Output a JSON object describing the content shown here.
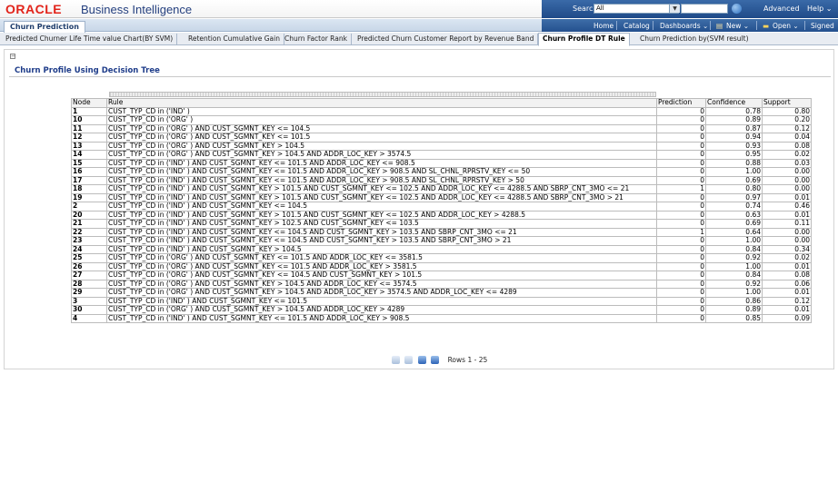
{
  "banner": {
    "oracle_logo": "ORACLE",
    "product": "Business Intelligence",
    "search_label": "Search",
    "search_scope": "All",
    "advanced": "Advanced",
    "help": "Help ⌄"
  },
  "nav": {
    "app_tab": "Churn Prediction",
    "home": "Home",
    "catalog": "Catalog",
    "dashboards": "Dashboards ⌄",
    "new": "New ⌄",
    "open": "Open ⌄",
    "signed": "Signed"
  },
  "page_tabs": [
    "Predicted Churner Life Time value Chart(BY SVM)",
    "Retention Cumulative Gain",
    "Churn Factor Rank",
    "Predicted Churn Customer Report by Revenue Band",
    "Churn Profile DT Rule",
    "Churn Prediction by(SVM result)"
  ],
  "section": {
    "title": "Churn Profile Using Decision Tree"
  },
  "table": {
    "headers": [
      "Node",
      "Rule",
      "Prediction",
      "Confidence",
      "Support"
    ],
    "rows": [
      [
        "1",
        "CUST_TYP_CD in ('IND' )",
        "0",
        "0.78",
        "0.80"
      ],
      [
        "10",
        "CUST_TYP_CD in ('ORG' )",
        "0",
        "0.89",
        "0.20"
      ],
      [
        "11",
        "CUST_TYP_CD in ('ORG' ) AND CUST_SGMNT_KEY <= 104.5",
        "0",
        "0.87",
        "0.12"
      ],
      [
        "12",
        "CUST_TYP_CD in ('ORG' ) AND CUST_SGMNT_KEY <= 101.5",
        "0",
        "0.94",
        "0.04"
      ],
      [
        "13",
        "CUST_TYP_CD in ('ORG' ) AND CUST_SGMNT_KEY > 104.5",
        "0",
        "0.93",
        "0.08"
      ],
      [
        "14",
        "CUST_TYP_CD in ('ORG' ) AND CUST_SGMNT_KEY > 104.5 AND ADDR_LOC_KEY > 3574.5",
        "0",
        "0.95",
        "0.02"
      ],
      [
        "15",
        "CUST_TYP_CD in ('IND' ) AND CUST_SGMNT_KEY <= 101.5 AND ADDR_LOC_KEY <= 908.5",
        "0",
        "0.88",
        "0.03"
      ],
      [
        "16",
        "CUST_TYP_CD in ('IND' ) AND CUST_SGMNT_KEY <= 101.5 AND ADDR_LOC_KEY > 908.5 AND SL_CHNL_RPRSTV_KEY <= 50",
        "0",
        "1.00",
        "0.00"
      ],
      [
        "17",
        "CUST_TYP_CD in ('IND' ) AND CUST_SGMNT_KEY <= 101.5 AND ADDR_LOC_KEY > 908.5 AND SL_CHNL_RPRSTV_KEY > 50",
        "0",
        "0.69",
        "0.00"
      ],
      [
        "18",
        "CUST_TYP_CD in ('IND' ) AND CUST_SGMNT_KEY > 101.5 AND CUST_SGMNT_KEY <= 102.5 AND ADDR_LOC_KEY <= 4288.5 AND SBRP_CNT_3MO <= 21",
        "1",
        "0.80",
        "0.00"
      ],
      [
        "19",
        "CUST_TYP_CD in ('IND' ) AND CUST_SGMNT_KEY > 101.5 AND CUST_SGMNT_KEY <= 102.5 AND ADDR_LOC_KEY <= 4288.5 AND SBRP_CNT_3MO > 21",
        "0",
        "0.97",
        "0.01"
      ],
      [
        "2",
        "CUST_TYP_CD in ('IND' ) AND CUST_SGMNT_KEY <= 104.5",
        "0",
        "0.74",
        "0.46"
      ],
      [
        "20",
        "CUST_TYP_CD in ('IND' ) AND CUST_SGMNT_KEY > 101.5 AND CUST_SGMNT_KEY <= 102.5 AND ADDR_LOC_KEY > 4288.5",
        "0",
        "0.63",
        "0.01"
      ],
      [
        "21",
        "CUST_TYP_CD in ('IND' ) AND CUST_SGMNT_KEY > 102.5 AND CUST_SGMNT_KEY <= 103.5",
        "0",
        "0.69",
        "0.11"
      ],
      [
        "22",
        "CUST_TYP_CD in ('IND' ) AND CUST_SGMNT_KEY <= 104.5 AND CUST_SGMNT_KEY > 103.5 AND SBRP_CNT_3MO <= 21",
        "1",
        "0.64",
        "0.00"
      ],
      [
        "23",
        "CUST_TYP_CD in ('IND' ) AND CUST_SGMNT_KEY <= 104.5 AND CUST_SGMNT_KEY > 103.5 AND SBRP_CNT_3MO > 21",
        "0",
        "1.00",
        "0.00"
      ],
      [
        "24",
        "CUST_TYP_CD in ('IND' ) AND CUST_SGMNT_KEY > 104.5",
        "0",
        "0.84",
        "0.34"
      ],
      [
        "25",
        "CUST_TYP_CD in ('ORG' ) AND CUST_SGMNT_KEY <= 101.5 AND ADDR_LOC_KEY <= 3581.5",
        "0",
        "0.92",
        "0.02"
      ],
      [
        "26",
        "CUST_TYP_CD in ('ORG' ) AND CUST_SGMNT_KEY <= 101.5 AND ADDR_LOC_KEY > 3581.5",
        "0",
        "1.00",
        "0.01"
      ],
      [
        "27",
        "CUST_TYP_CD in ('ORG' ) AND CUST_SGMNT_KEY <= 104.5 AND CUST_SGMNT_KEY > 101.5",
        "0",
        "0.84",
        "0.08"
      ],
      [
        "28",
        "CUST_TYP_CD in ('ORG' ) AND CUST_SGMNT_KEY > 104.5 AND ADDR_LOC_KEY <= 3574.5",
        "0",
        "0.92",
        "0.06"
      ],
      [
        "29",
        "CUST_TYP_CD in ('ORG' ) AND CUST_SGMNT_KEY > 104.5 AND ADDR_LOC_KEY > 3574.5 AND ADDR_LOC_KEY <= 4289",
        "0",
        "1.00",
        "0.01"
      ],
      [
        "3",
        "CUST_TYP_CD in ('IND' ) AND CUST_SGMNT_KEY <= 101.5",
        "0",
        "0.86",
        "0.12"
      ],
      [
        "30",
        "CUST_TYP_CD in ('ORG' ) AND CUST_SGMNT_KEY > 104.5 AND ADDR_LOC_KEY > 4289",
        "0",
        "0.89",
        "0.01"
      ],
      [
        "4",
        "CUST_TYP_CD in ('IND' ) AND CUST_SGMNT_KEY <= 101.5 AND ADDR_LOC_KEY > 908.5",
        "0",
        "0.85",
        "0.09"
      ]
    ]
  },
  "pager": {
    "rows_text": "Rows 1 - 25"
  },
  "colors": {
    "oracle_red": "#e2231a",
    "brand_blue": "#25407f",
    "nav_blue": "#24508e",
    "title_blue": "#1f3d8a"
  }
}
